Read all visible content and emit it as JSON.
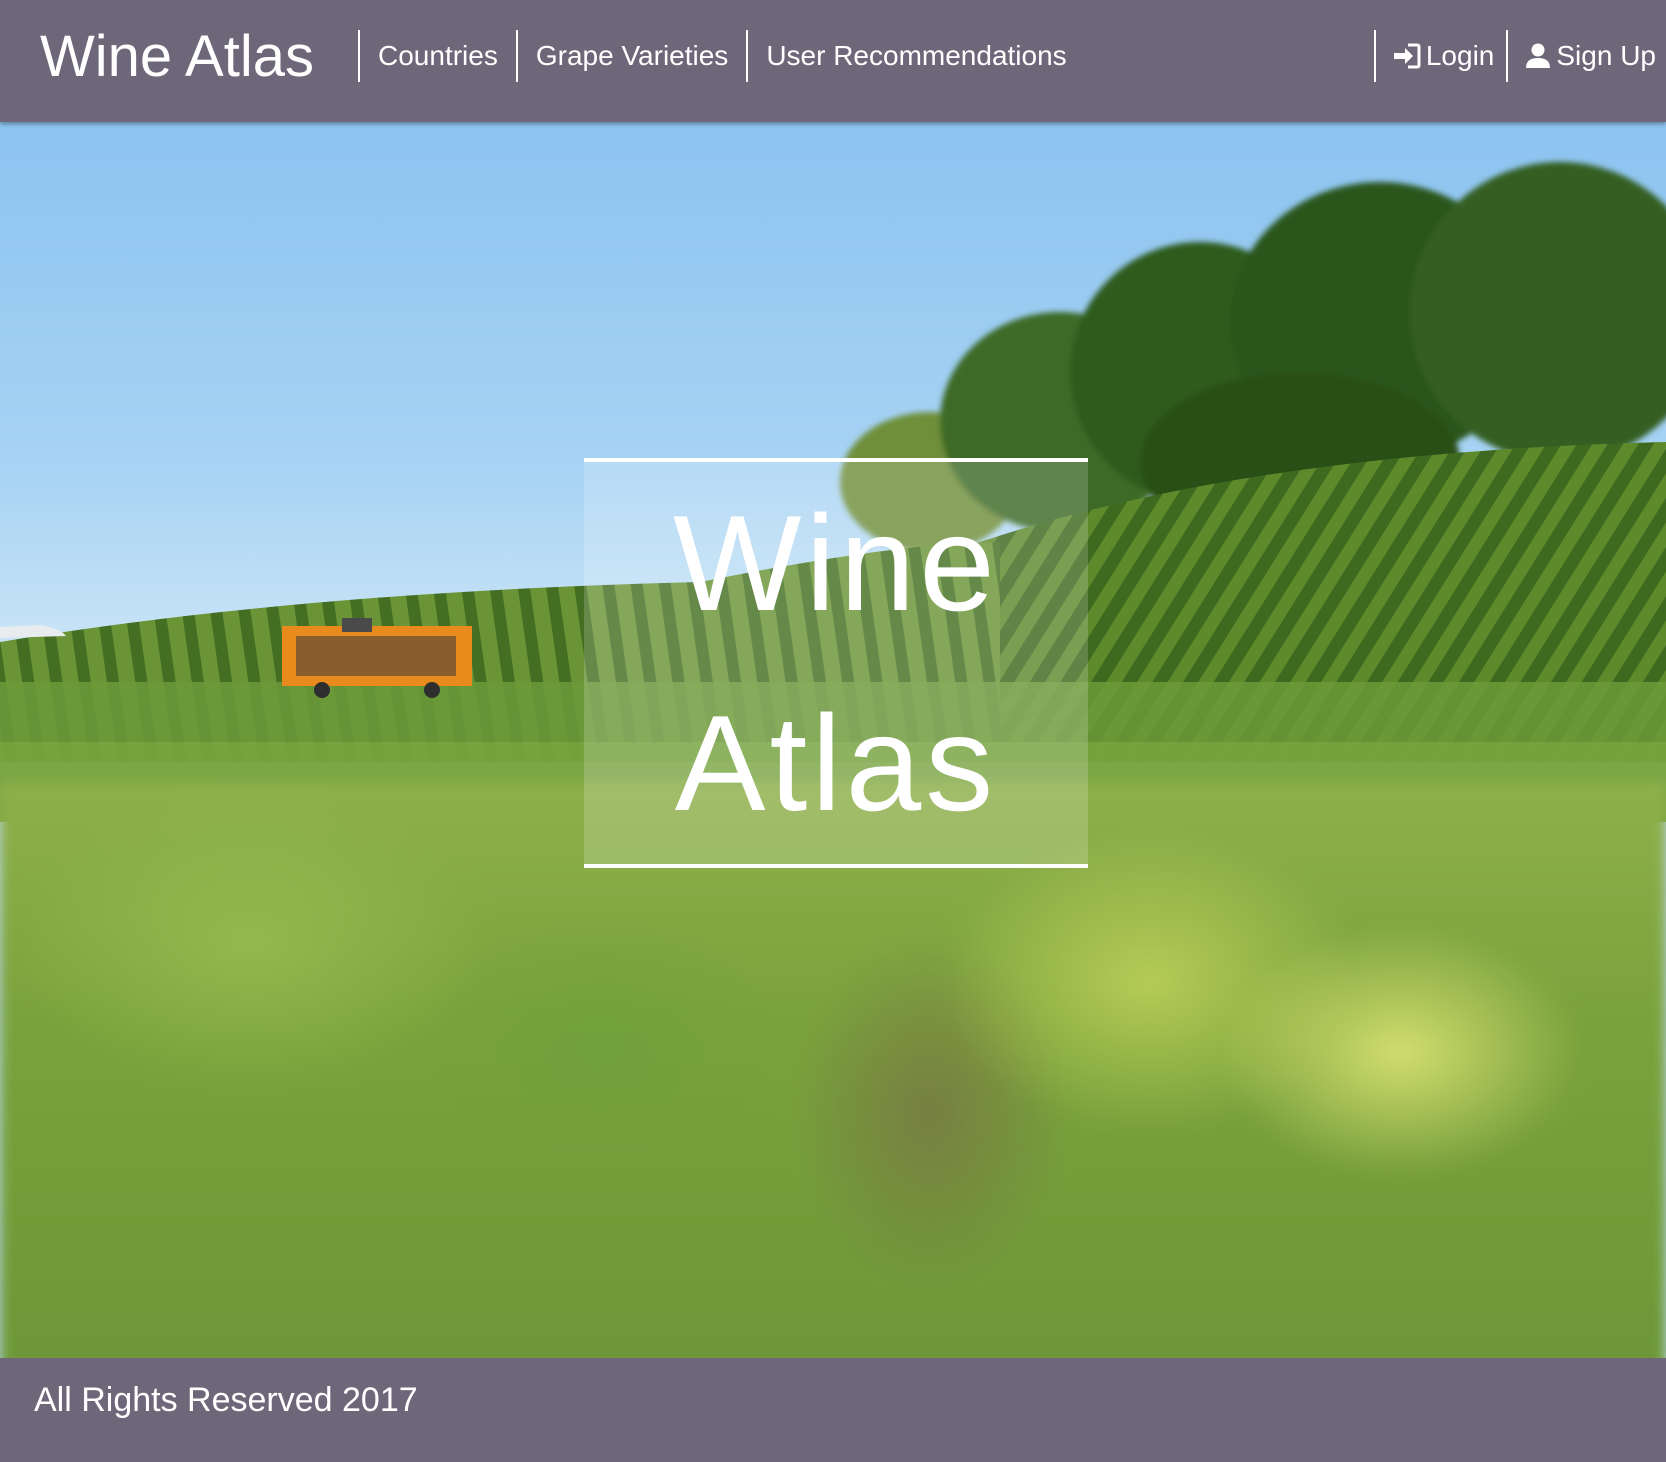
{
  "navbar": {
    "brand": "Wine Atlas",
    "links": [
      {
        "label": "Countries"
      },
      {
        "label": "Grape Varieties"
      },
      {
        "label": "User Recommendations"
      }
    ],
    "login_label": "Login",
    "login_icon": "login-icon",
    "signup_label": "Sign Up",
    "signup_icon": "user-icon",
    "background_color": "#6e6779"
  },
  "hero": {
    "title_line1": "Wine",
    "title_line2": "Atlas",
    "background_image": "vineyard-photo"
  },
  "footer": {
    "text": "All Rights Reserved 2017"
  }
}
